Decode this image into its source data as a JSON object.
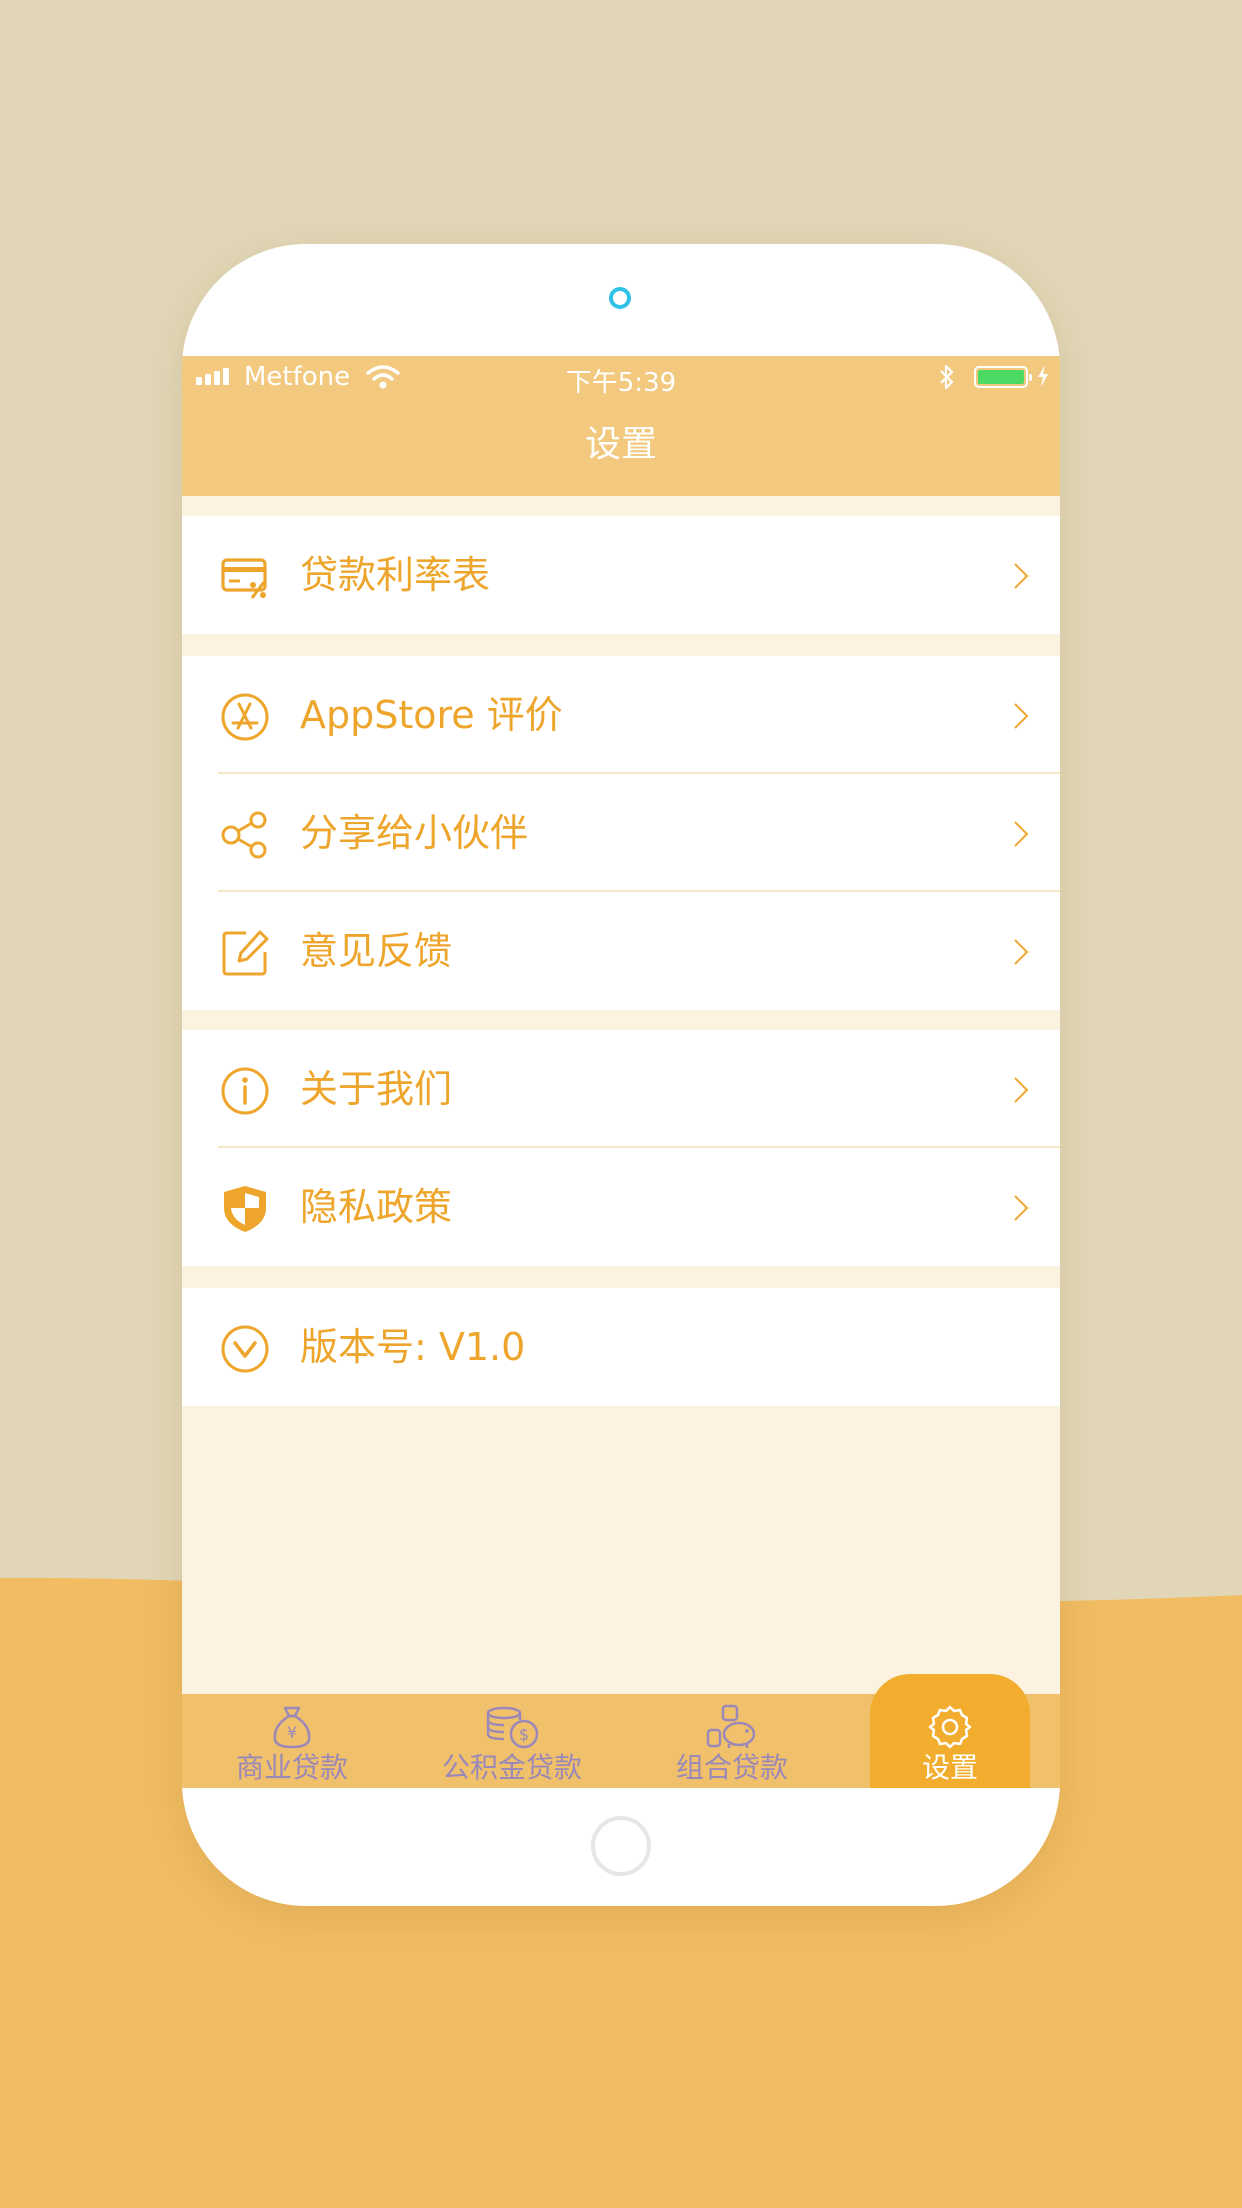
{
  "colors": {
    "background_top": "#e1d7b8",
    "background_bottom": "#f1bc62",
    "accent": "#eea52c",
    "header": "#f2c97e",
    "tab_inactive": "#9a88b8",
    "battery": "#4cd964"
  },
  "status_bar": {
    "carrier": "Metfone",
    "time": "下午5:39",
    "icons": [
      "signal-icon",
      "wifi-icon",
      "bluetooth-icon",
      "battery-icon",
      "charging-icon"
    ]
  },
  "header": {
    "title": "设置"
  },
  "menu": {
    "items": [
      {
        "label": "贷款利率表",
        "icon": "rate-card-icon"
      },
      {
        "label": "AppStore 评价",
        "icon": "appstore-icon"
      },
      {
        "label": "分享给小伙伴",
        "icon": "share-icon"
      },
      {
        "label": "意见反馈",
        "icon": "feedback-edit-icon"
      },
      {
        "label": "关于我们",
        "icon": "info-icon"
      },
      {
        "label": "隐私政策",
        "icon": "shield-icon"
      },
      {
        "label": "版本号: V1.0",
        "icon": "version-down-icon"
      }
    ]
  },
  "tabbar": {
    "tabs": [
      {
        "label": "商业贷款",
        "icon": "money-bag-icon"
      },
      {
        "label": "公积金贷款",
        "icon": "coins-icon"
      },
      {
        "label": "组合贷款",
        "icon": "piggy-bank-icon"
      },
      {
        "label": "设置",
        "icon": "gear-icon",
        "active": true
      }
    ]
  }
}
